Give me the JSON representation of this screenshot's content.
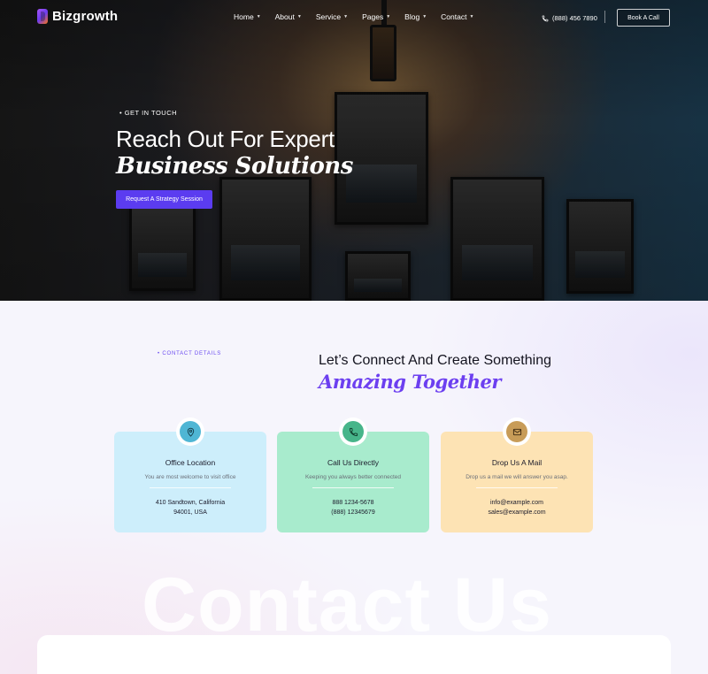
{
  "brand": {
    "name": "Bizgrowth"
  },
  "nav": {
    "items": [
      {
        "label": "Home",
        "has_dropdown": true
      },
      {
        "label": "About",
        "has_dropdown": true
      },
      {
        "label": "Service",
        "has_dropdown": true
      },
      {
        "label": "Pages",
        "has_dropdown": true
      },
      {
        "label": "Blog",
        "has_dropdown": true
      },
      {
        "label": "Contact",
        "has_dropdown": true
      }
    ],
    "phone": "(888) 456 7890",
    "cta_label": "Book A Call"
  },
  "hero": {
    "eyebrow": "GET IN TOUCH",
    "title_line1": "Reach Out For Expert",
    "title_line2": "Business Solutions",
    "cta_label": "Request A Strategy Session"
  },
  "contact": {
    "eyebrow": "CONTACT DETAILS",
    "title_line1": "Let’s Connect And Create Something",
    "title_line2": "Amazing Together",
    "cards": [
      {
        "icon": "map-pin-icon",
        "title": "Office Location",
        "subtitle": "You are most welcome to visit office",
        "line1": "410 Sandtown, California",
        "line2": "94001, USA",
        "bg": "#cdeefb",
        "icon_bg": "#4fb6d4"
      },
      {
        "icon": "phone-icon",
        "title": "Call Us Directly",
        "subtitle": "Keeping you always better connected",
        "line1": "888 1234-5678",
        "line2": "(888) 12345679",
        "bg": "#a8ebcd",
        "icon_bg": "#47b58a"
      },
      {
        "icon": "mail-icon",
        "title": "Drop Us A Mail",
        "subtitle": "Drop us a mail we will answer you asap.",
        "line1": "info@example.com",
        "line2": "sales@example.com",
        "bg": "#fde3b4",
        "icon_bg": "#c89c58"
      }
    ],
    "watermark": "Contact Us"
  },
  "colors": {
    "accent": "#5b3cf0",
    "accent_text": "#6c3ff0"
  }
}
